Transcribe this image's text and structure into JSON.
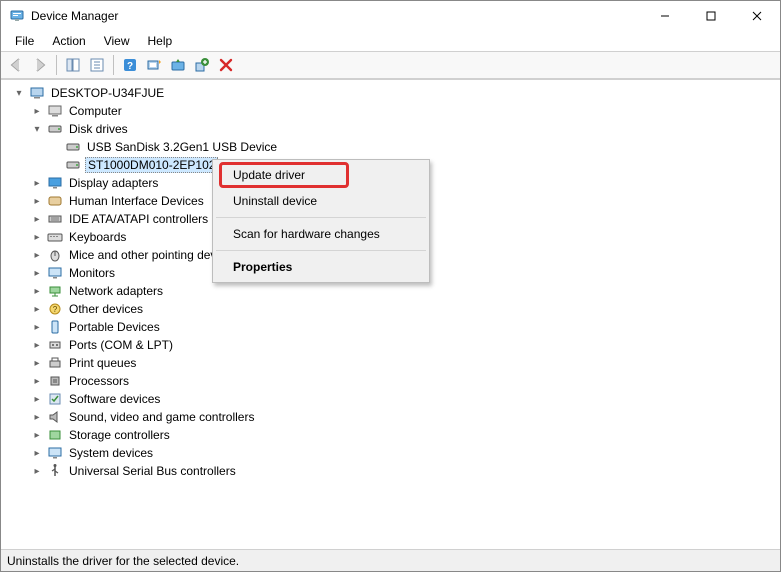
{
  "window": {
    "title": "Device Manager"
  },
  "menubar": {
    "file": "File",
    "action": "Action",
    "view": "View",
    "help": "Help"
  },
  "tree": {
    "root": "DESKTOP-U34FJUE",
    "computer": "Computer",
    "disk_drives": "Disk drives",
    "disk1": "USB  SanDisk 3.2Gen1 USB Device",
    "disk2": "ST1000DM010-2EP102",
    "display_adapters": "Display adapters",
    "hid": "Human Interface Devices",
    "ide": "IDE ATA/ATAPI controllers",
    "keyboards": "Keyboards",
    "mice": "Mice and other pointing devices",
    "monitors": "Monitors",
    "network": "Network adapters",
    "other": "Other devices",
    "portable": "Portable Devices",
    "ports": "Ports (COM & LPT)",
    "print_queues": "Print queues",
    "processors": "Processors",
    "software": "Software devices",
    "sound": "Sound, video and game controllers",
    "storage": "Storage controllers",
    "system": "System devices",
    "usb": "Universal Serial Bus controllers"
  },
  "context_menu": {
    "update": "Update driver",
    "uninstall": "Uninstall device",
    "scan": "Scan for hardware changes",
    "properties": "Properties"
  },
  "statusbar": {
    "text": "Uninstalls the driver for the selected device."
  }
}
